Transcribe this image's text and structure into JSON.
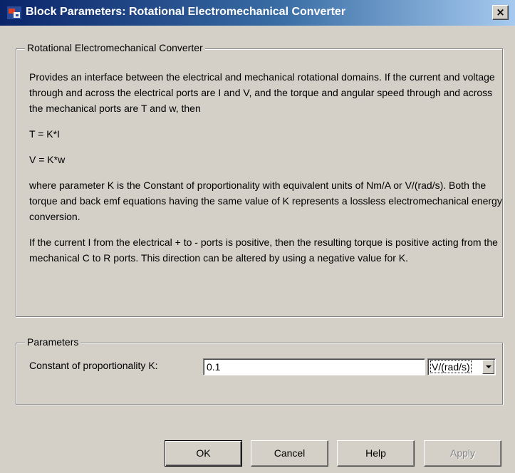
{
  "window": {
    "title": "Block Parameters: Rotational Electromechanical Converter",
    "close_label": "×"
  },
  "description": {
    "group_label": "Rotational Electromechanical Converter",
    "paragraphs": [
      "Provides an interface between the electrical and mechanical rotational domains. If the current and voltage through and across the electrical ports are I and V, and the torque and angular speed through and across the mechanical ports are T and w, then",
      "T = K*I",
      "V = K*w",
      "where parameter K is the Constant of proportionality with equivalent units of Nm/A or V/(rad/s). Both the torque and back emf equations having the same value of K represents a lossless electromechanical energy conversion.",
      "If the current I from the electrical + to - ports is positive, then the resulting torque is positive acting from the mechanical C to R ports. This direction can be altered by using a negative value for K."
    ]
  },
  "parameters": {
    "group_label": "Parameters",
    "k_label": "Constant of proportionality K:",
    "k_value": "0.1",
    "k_unit": "V/(rad/s)"
  },
  "buttons": {
    "ok": "OK",
    "cancel": "Cancel",
    "help": "Help",
    "apply": "Apply"
  }
}
